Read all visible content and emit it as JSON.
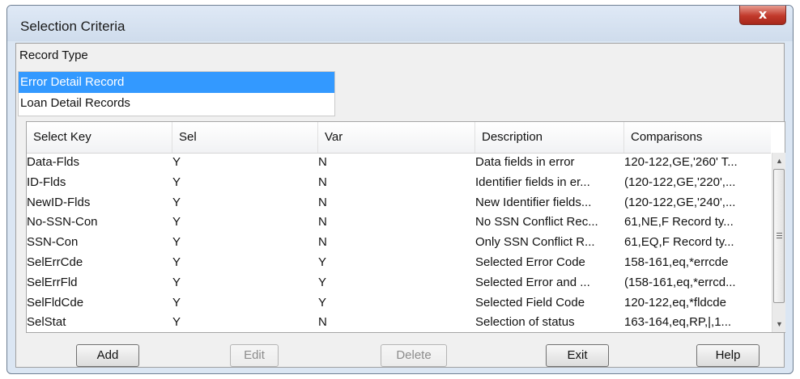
{
  "window": {
    "title": "Selection Criteria",
    "close_glyph": "x"
  },
  "record_type": {
    "label": "Record Type",
    "items": [
      "Error Detail Record",
      "Loan Detail Records"
    ],
    "selected_index": 0
  },
  "grid": {
    "columns": [
      "Select Key",
      "Sel",
      "Var",
      "Description",
      "Comparisons"
    ],
    "rows": [
      [
        "Data-Flds",
        "Y",
        "N",
        "Data fields in error",
        "120-122,GE,'260'  T..."
      ],
      [
        "ID-Flds",
        "Y",
        "N",
        "Identifier fields in er...",
        "(120-122,GE,'220',..."
      ],
      [
        "NewID-Flds",
        "Y",
        "N",
        "New Identifier fields...",
        "(120-122,GE,'240',..."
      ],
      [
        "No-SSN-Con",
        "Y",
        "N",
        "No SSN Conflict Rec...",
        "61,NE,F  Record ty..."
      ],
      [
        "SSN-Con",
        "Y",
        "N",
        "Only SSN Conflict R...",
        "61,EQ,F  Record ty..."
      ],
      [
        "SelErrCde",
        "Y",
        "Y",
        "Selected Error Code",
        "158-161,eq,*errcde"
      ],
      [
        "SelErrFld",
        "Y",
        "Y",
        "Selected Error and ...",
        "(158-161,eq,*errcd..."
      ],
      [
        "SelFldCde",
        "Y",
        "Y",
        "Selected Field Code",
        "120-122,eq,*fldcde"
      ],
      [
        "SelStat",
        "Y",
        "N",
        "Selection of status",
        "163-164,eq,RP,|,1..."
      ]
    ]
  },
  "buttons": {
    "add": "Add",
    "edit": "Edit",
    "delete": "Delete",
    "exit": "Exit",
    "help": "Help"
  }
}
